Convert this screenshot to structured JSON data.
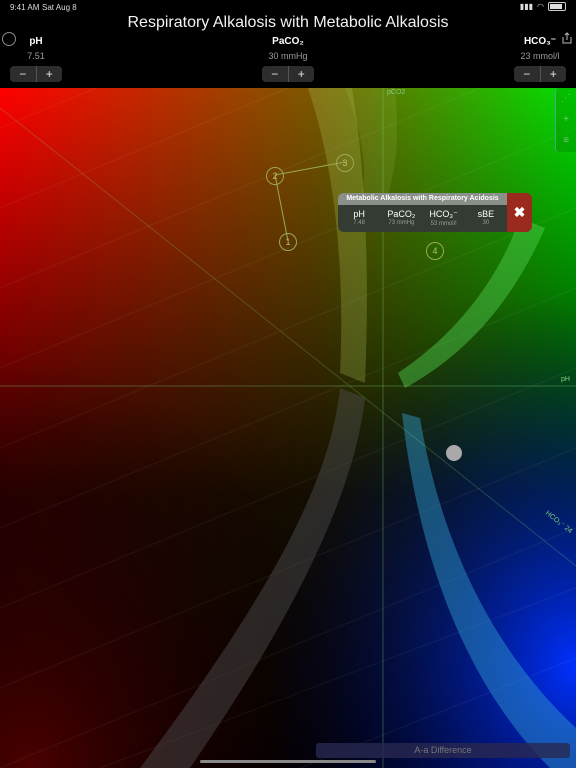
{
  "status": {
    "time": "9:41 AM",
    "date": "Sat Aug 8"
  },
  "header": {
    "title": "Respiratory Alkalosis with Metabolic Alkalosis"
  },
  "params": [
    {
      "label": "pH",
      "value": "7.51"
    },
    {
      "label": "PaCO₂",
      "value": "30 mmHg"
    },
    {
      "label": "HCO₃⁻",
      "value": "23 mmol/l"
    }
  ],
  "stepper": {
    "minus": "−",
    "plus": "+"
  },
  "plot": {
    "axis_pco2": "pCO2",
    "axis_ph": "pH",
    "axis_hco3": "HCO₃⁻ 24",
    "markers": [
      "1",
      "2",
      "3",
      "4"
    ]
  },
  "popup": {
    "title": "Metabolic Alkalosis with Respiratory Acidosis",
    "columns": [
      {
        "name": "pH",
        "value": "7.48"
      },
      {
        "name": "PaCO₂",
        "value": "73 mmHg"
      },
      {
        "name": "HCO₃⁻",
        "value": "53 mmol/l"
      },
      {
        "name": "sBE",
        "value": "30"
      }
    ],
    "close": "✖"
  },
  "bottom": {
    "aa_label": "A-a Difference"
  },
  "colors": {
    "accent_green": "#39d43a",
    "close_red": "#9a2a1e"
  }
}
